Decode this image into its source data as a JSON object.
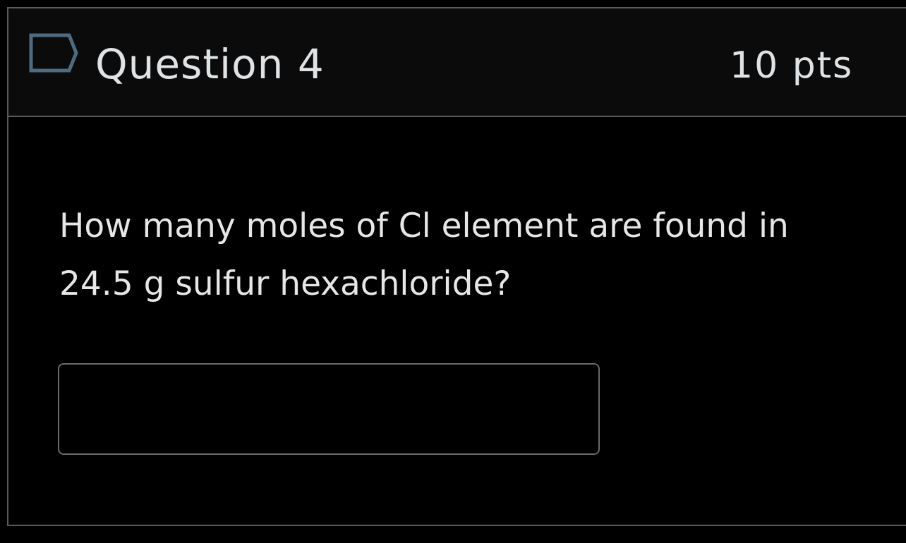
{
  "question": {
    "title": "Question 4",
    "points": "10 pts",
    "text": "How many moles of Cl element are found in 24.5 g sulfur hexachloride?",
    "flag_icon": "flag-bookmark-icon",
    "answer": {
      "value": "",
      "placeholder": ""
    }
  },
  "colors": {
    "background": "#000000",
    "header_background": "#0b0b0b",
    "border": "#5a5a5a",
    "text": "#e6e6e6",
    "flag_stroke": "#4f6b82"
  }
}
